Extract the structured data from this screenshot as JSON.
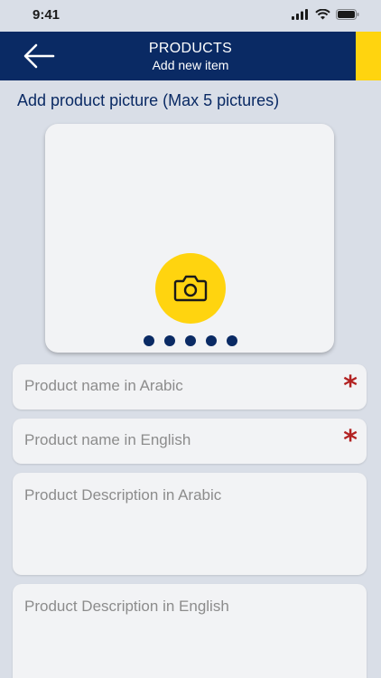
{
  "status_bar": {
    "time": "9:41",
    "icons": [
      "signal-icon",
      "wifi-icon",
      "battery-icon"
    ]
  },
  "header": {
    "title": "PRODUCTS",
    "subtitle": "Add new item",
    "back_icon": "arrow-left-icon",
    "background": "#0a2a64",
    "accent": "#ffd40f"
  },
  "picture_section": {
    "label": "Add product picture (Max 5 pictures)",
    "camera_icon": "camera-icon",
    "slot_count": 5
  },
  "form": {
    "name_ar_placeholder": "Product name in Arabic",
    "name_en_placeholder": "Product name in English",
    "desc_ar_placeholder": "Product Description in Arabic",
    "desc_en_placeholder": "Product Description in English",
    "required_mark": "*",
    "required_color": "#b22222"
  }
}
